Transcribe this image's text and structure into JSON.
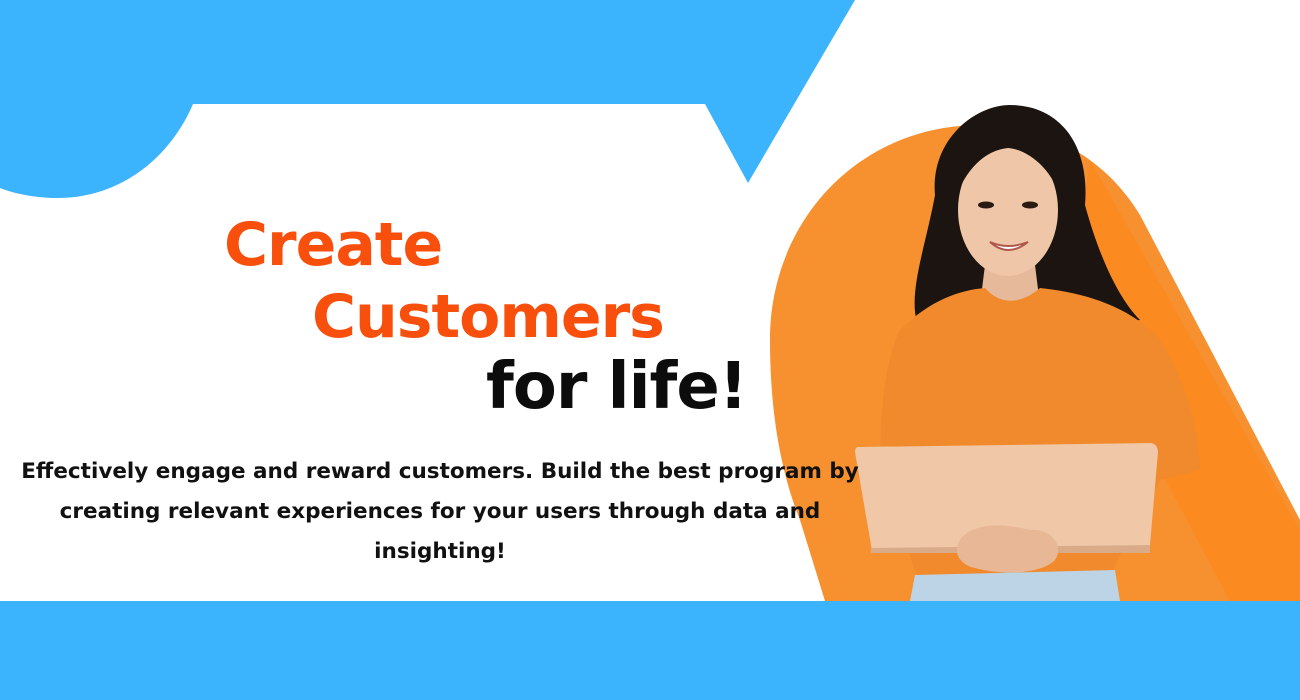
{
  "banner": {
    "headline_line1": "Create",
    "headline_line2": "Customers",
    "headline_line3": "for life!",
    "body_text": "Effectively engage and reward customers. Build the best program by creating relevant experiences for your users through data and insighting!"
  },
  "colors": {
    "sky_blue": "#3bb3fd",
    "accent_orange": "#f8500c",
    "sweater_orange": "#f08a2c",
    "headline_dark": "#0c0c0c"
  },
  "illustration": {
    "subject": "smiling woman in orange sweater holding laptop",
    "icons": [
      "person-photo",
      "laptop-icon"
    ]
  }
}
